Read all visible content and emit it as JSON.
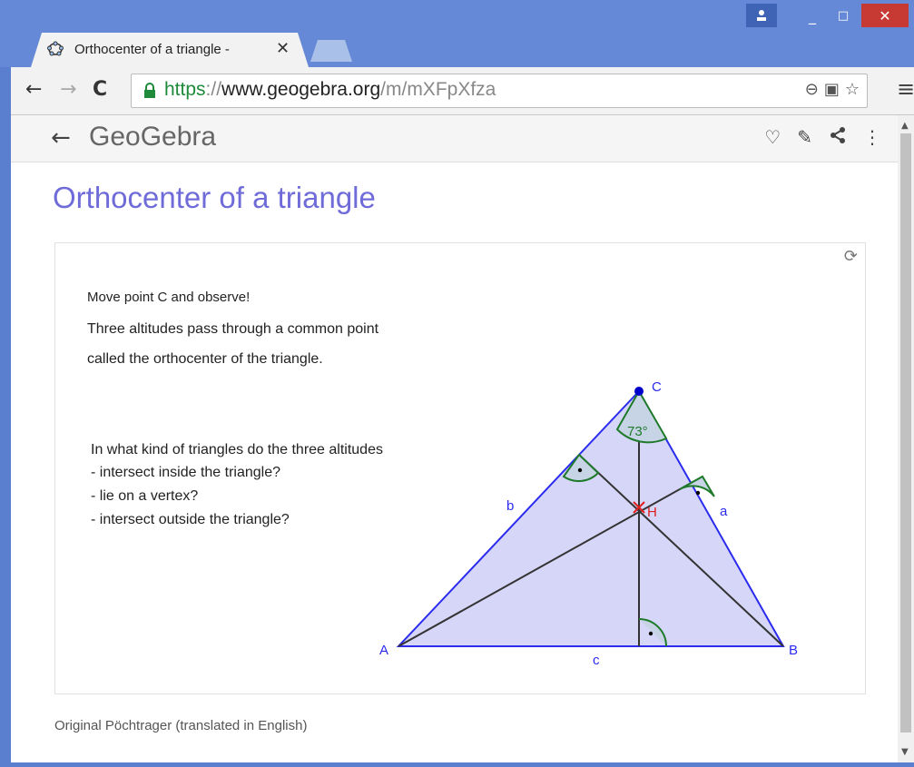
{
  "window": {
    "user_icon": "user-icon",
    "min": "_",
    "max": "□",
    "close": "✕"
  },
  "tab": {
    "title": "Orthocenter of a triangle -",
    "close": "✕"
  },
  "nav": {
    "back": "←",
    "forward": "→",
    "reload": "C"
  },
  "address": {
    "scheme": "https",
    "sep": "://",
    "host": "www.geogebra.org",
    "path": "/m/mXFpXfza"
  },
  "omnibox_icons": [
    "zoom-icon",
    "translate-icon",
    "star-icon"
  ],
  "menu": "≡",
  "geogebra": {
    "back": "←",
    "logo": "GeoGebra",
    "actions": [
      "♡",
      "✎",
      "share",
      "⋮"
    ]
  },
  "page": {
    "title": "Orthocenter of a triangle",
    "caption": "Original Pöchtrager (translated in English)"
  },
  "applet": {
    "line1": "Move point C and observe!",
    "line2": "Three altitudes pass through a common point",
    "line3": "called the orthocenter of the triangle.",
    "q0": "In what kind of triangles do the three altitudes",
    "q1": "- intersect inside the triangle?",
    "q2": "- lie on a vertex?",
    "q3": "- intersect outside the triangle?",
    "labels": {
      "A": "A",
      "B": "B",
      "C": "C",
      "H": "H",
      "a": "a",
      "b": "b",
      "c": "c",
      "angle": "73°"
    }
  },
  "colors": {
    "title": "#6f6cd9",
    "triangle_fill": "#d6d6f8",
    "triangle_edge": "#2b2bf0",
    "angle": "#1e7a2a",
    "orthocenter": "#e02020"
  }
}
